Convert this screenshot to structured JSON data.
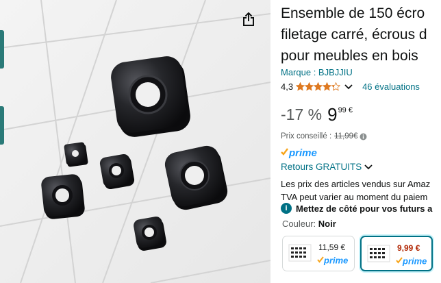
{
  "title_lines": [
    "Ensemble de 150 écro",
    "filetage carré, écrous d",
    "pour meubles en bois"
  ],
  "brand": "Marque : BJBJJIU",
  "rating": {
    "value": "4,3",
    "stars": 4.3,
    "reviews": "46 évaluations"
  },
  "price": {
    "discount": "-17 %",
    "whole": "9",
    "fraction": "99 €"
  },
  "list_price": {
    "label": "Prix conseillé :",
    "value": "11,99€"
  },
  "prime_label": "prime",
  "returns": "Retours GRATUITS",
  "tax_lines": [
    "Les prix des articles vendus sur Amaz",
    "TVA peut varier au moment du paiem"
  ],
  "save_later": "Mettez de côté pour vos futurs a",
  "color": {
    "label": "Couleur:",
    "value": "Noir"
  },
  "variants": [
    {
      "price": "11,59 €",
      "prime": "prime",
      "selected": false
    },
    {
      "price": "9,99 €",
      "prime": "prime",
      "selected": true
    }
  ],
  "colors": {
    "link": "#007185",
    "star": "#de7921",
    "deal": "#b12704",
    "nut": "#1b1c20"
  },
  "icons": [
    "share-icon",
    "star-icon",
    "chevron-down-icon",
    "info-icon",
    "prime-check-icon"
  ]
}
